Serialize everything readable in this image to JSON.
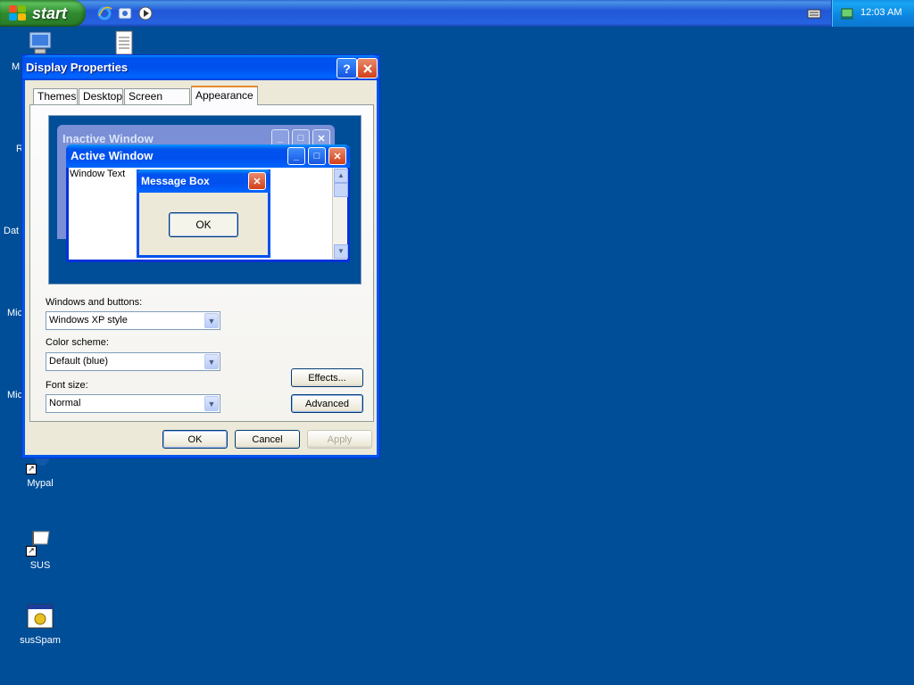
{
  "taskbar": {
    "start_label": "start",
    "quick_launch": [
      "internet-explorer-icon",
      "outlook-express-icon",
      "media-player-icon"
    ],
    "tray_icons": [
      "keyboard-icon",
      "network-icon"
    ],
    "clock": "12:03 AM"
  },
  "desktop": {
    "icons": [
      {
        "label": "Mypal",
        "icon": "mypal-icon"
      },
      {
        "label": "SUS",
        "icon": "sus-icon"
      },
      {
        "label": "susSpam",
        "icon": "susspam-icon"
      }
    ],
    "cut_labels": [
      "M",
      "R",
      "Dat",
      "Mic",
      "Mic"
    ]
  },
  "dialog": {
    "title": "Display Properties",
    "help_label": "?",
    "tabs": [
      {
        "label": "Themes"
      },
      {
        "label": "Desktop"
      },
      {
        "label": "Screen Saver"
      },
      {
        "label": "Appearance"
      }
    ],
    "active_tab": "Appearance",
    "preview": {
      "inactive_title": "Inactive Window",
      "active_title": "Active Window",
      "window_text": "Window Text",
      "message_box_title": "Message Box",
      "ok_label": "OK"
    },
    "fields": {
      "windows_buttons_label": "Windows and buttons:",
      "windows_buttons_value": "Windows XP style",
      "color_scheme_label": "Color scheme:",
      "color_scheme_value": "Default (blue)",
      "font_size_label": "Font size:",
      "font_size_value": "Normal"
    },
    "buttons": {
      "effects": "Effects...",
      "advanced": "Advanced",
      "ok": "OK",
      "cancel": "Cancel",
      "apply": "Apply"
    }
  },
  "colors": {
    "desktop": "#004e98",
    "titlebar": "#0050ee",
    "start_green": "#2f8b2f",
    "tab_highlight": "#e68b2c"
  }
}
